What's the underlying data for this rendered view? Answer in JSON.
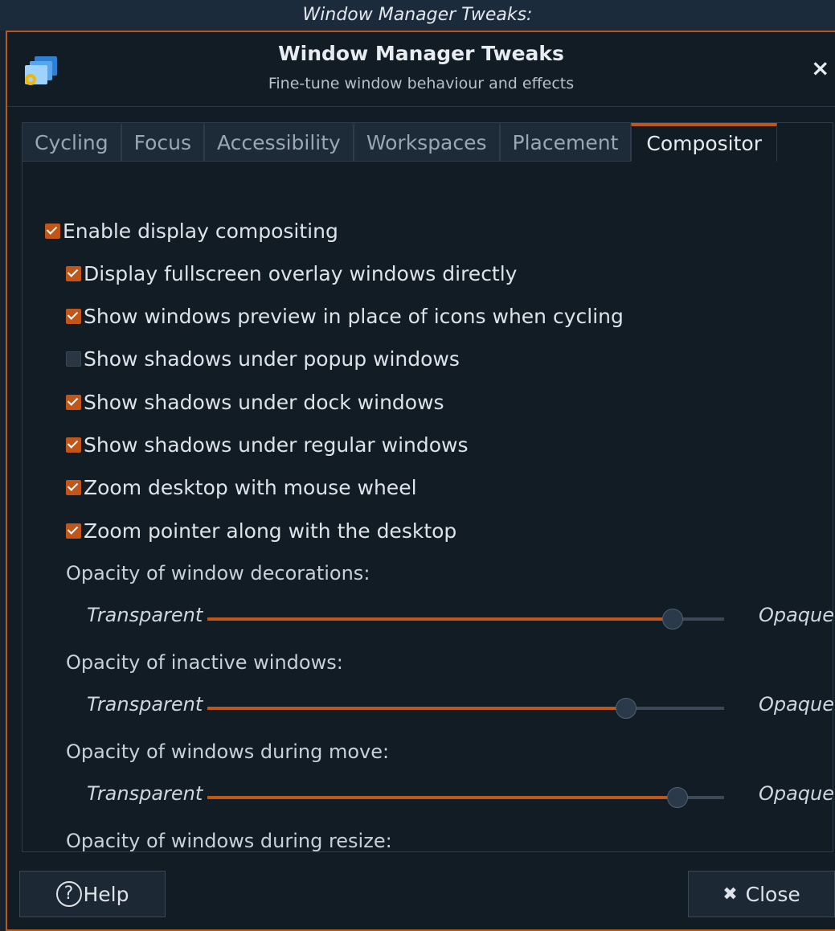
{
  "outer_title": "Window Manager Tweaks:",
  "header": {
    "title": "Window Manager Tweaks",
    "subtitle": "Fine-tune window behaviour and effects",
    "close_glyph": "×"
  },
  "tabs": [
    {
      "label": "Cycling",
      "active": false
    },
    {
      "label": "Focus",
      "active": false
    },
    {
      "label": "Accessibility",
      "active": false
    },
    {
      "label": "Workspaces",
      "active": false
    },
    {
      "label": "Placement",
      "active": false
    },
    {
      "label": "Compositor",
      "active": true
    }
  ],
  "compositor": {
    "enable": {
      "label": "Enable display compositing",
      "checked": true
    },
    "options": [
      {
        "label": "Display fullscreen overlay windows directly",
        "checked": true
      },
      {
        "label": "Show windows preview in place of icons when cycling",
        "checked": true
      },
      {
        "label": "Show shadows under popup windows",
        "checked": false
      },
      {
        "label": "Show shadows under dock windows",
        "checked": true
      },
      {
        "label": "Show shadows under regular windows",
        "checked": true
      },
      {
        "label": "Zoom desktop with mouse wheel",
        "checked": true
      },
      {
        "label": "Zoom pointer along with the desktop",
        "checked": true
      }
    ],
    "sliders": [
      {
        "label": "Opacity of window decorations:",
        "min_label": "Transparent",
        "max_label": "Opaque",
        "value_pct": 90
      },
      {
        "label": "Opacity of inactive windows:",
        "min_label": "Transparent",
        "max_label": "Opaque",
        "value_pct": 81
      },
      {
        "label": "Opacity of windows during move:",
        "min_label": "Transparent",
        "max_label": "Opaque",
        "value_pct": 91
      }
    ],
    "resize_label": "Opacity of windows during resize:"
  },
  "buttons": {
    "help_label": "Help",
    "help_glyph": "?",
    "close_label": "Close",
    "close_glyph": "✖"
  },
  "colors": {
    "accent": "#c0561a",
    "background": "#121c25",
    "titlebar": "#1b2b3b"
  },
  "icons": {
    "app": "window-manager-settings-icon",
    "help": "help-circle-icon",
    "close": "close-icon"
  }
}
